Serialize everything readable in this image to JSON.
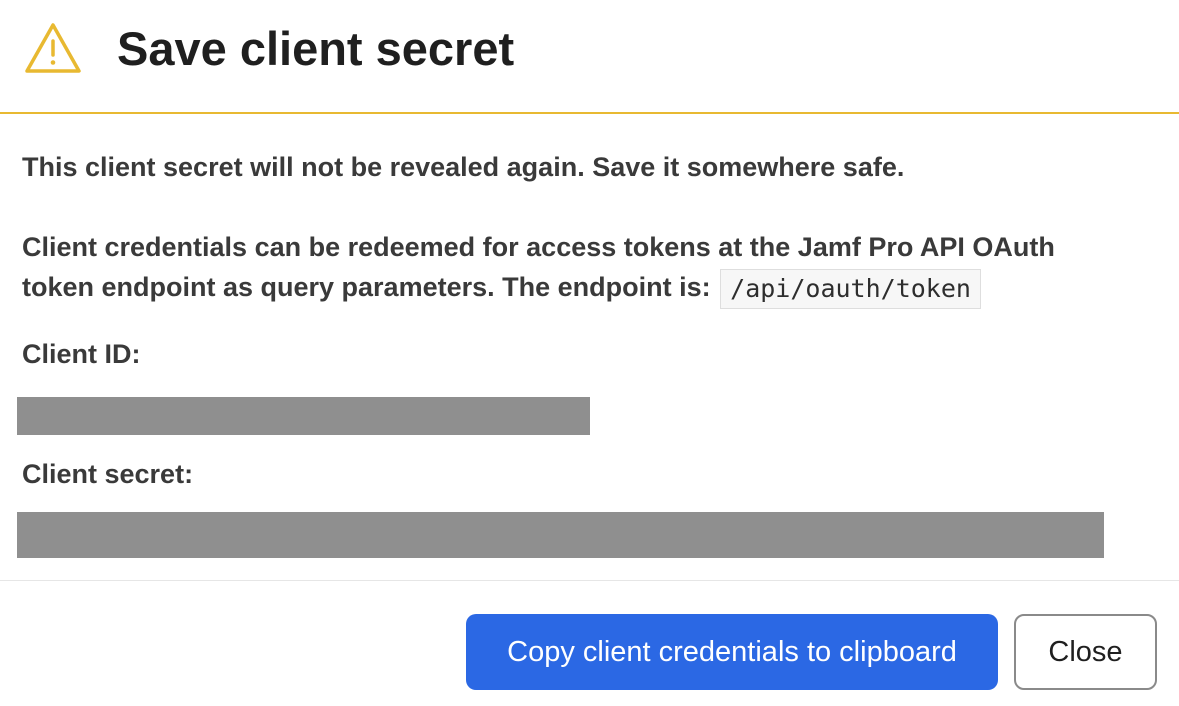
{
  "dialog": {
    "title": "Save client secret",
    "icon": "warning-icon",
    "accent_color": "#e8b931"
  },
  "body": {
    "warning": "This client secret will not be revealed again. Save it somewhere safe.",
    "info_line1": "Client credentials can be redeemed for access tokens at the Jamf Pro API OAuth",
    "info_line2": "token endpoint as query parameters. The endpoint is:",
    "endpoint": "/api/oauth/token"
  },
  "fields": {
    "client_id_label": "Client ID:",
    "client_secret_label": "Client secret:"
  },
  "buttons": {
    "copy_label": "Copy client credentials to clipboard",
    "close_label": "Close",
    "primary_color": "#2b68e4"
  }
}
